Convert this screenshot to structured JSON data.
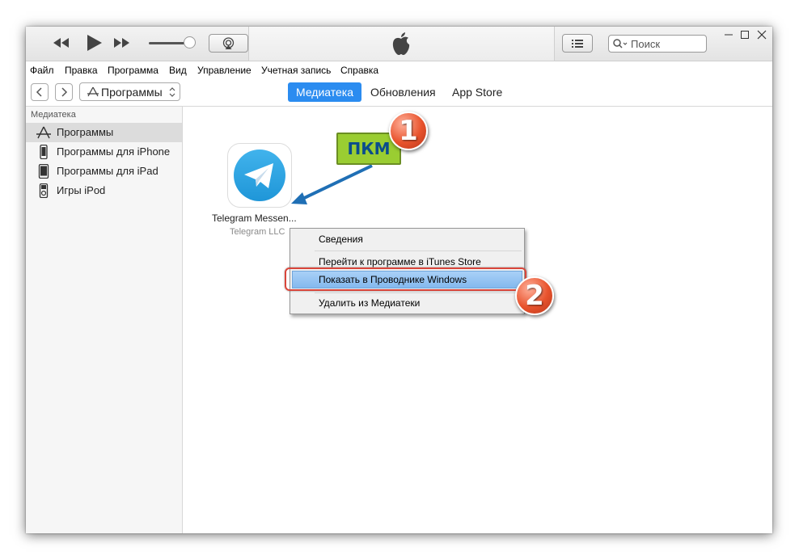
{
  "menu": {
    "items": [
      "Файл",
      "Правка",
      "Программа",
      "Вид",
      "Управление",
      "Учетная запись",
      "Справка"
    ]
  },
  "toolbar": {
    "search_placeholder": "Поиск"
  },
  "nav": {
    "media_selector": "Программы",
    "tabs": [
      "Медиатека",
      "Обновления",
      "App Store"
    ],
    "active_tab": "Медиатека"
  },
  "sidebar": {
    "heading": "Медиатека",
    "items": [
      {
        "label": "Программы",
        "icon": "app-store-icon",
        "selected": true
      },
      {
        "label": "Программы для iPhone",
        "icon": "iphone-icon",
        "selected": false
      },
      {
        "label": "Программы для iPad",
        "icon": "ipad-icon",
        "selected": false
      },
      {
        "label": "Игры iPod",
        "icon": "ipod-icon",
        "selected": false
      }
    ]
  },
  "content": {
    "app": {
      "name": "Telegram Messen...",
      "developer": "Telegram LLC",
      "icon": "telegram-icon"
    }
  },
  "context_menu": {
    "items": [
      "Сведения",
      "Перейти к программе в iTunes Store",
      "Показать в Проводнике Windows",
      "Удалить из Медиатеки"
    ],
    "highlighted_index": 2
  },
  "annotations": {
    "pkm_label": "ПКМ",
    "step1": "1",
    "step2": "2"
  },
  "colors": {
    "accent_blue": "#2b8cf0",
    "annotation_red": "#e8532d",
    "annotation_green": "#9acd32",
    "arrow_blue": "#1f6fb5"
  }
}
